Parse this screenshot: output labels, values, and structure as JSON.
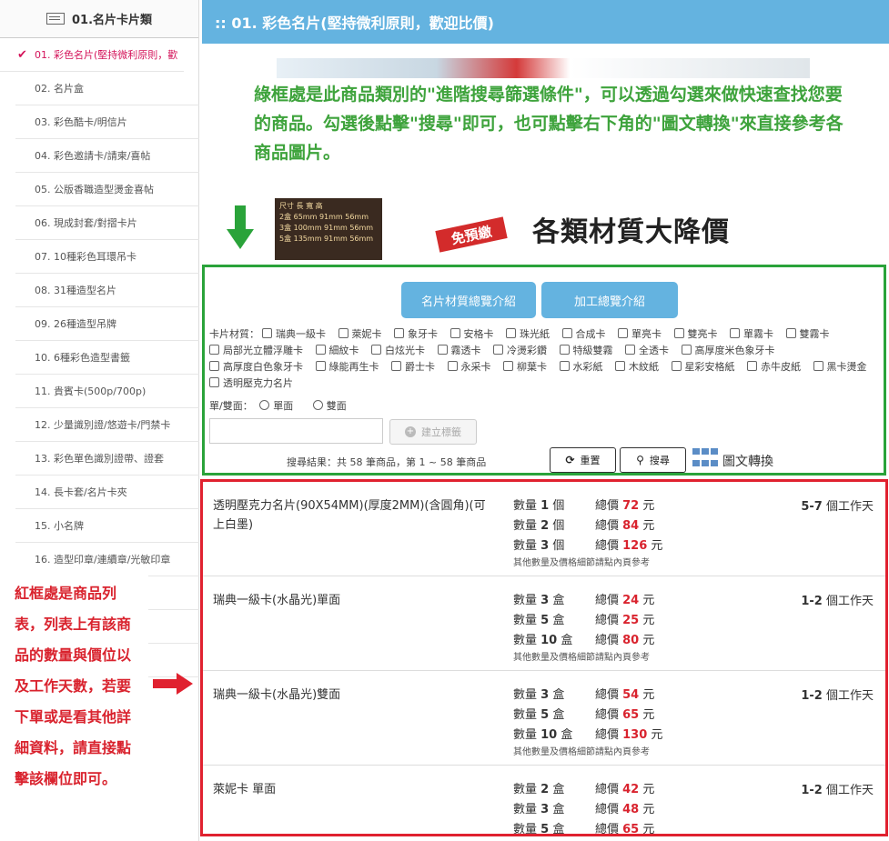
{
  "sidebar": {
    "header": "01.名片卡片類",
    "items": [
      "01. 彩色名片(堅持微利原則，歡",
      "02. 名片盒",
      "03. 彩色酷卡/明信片",
      "04. 彩色邀請卡/請柬/喜帖",
      "05. 公版香職造型燙金喜帖",
      "06. 現成封套/對摺卡片",
      "07. 10種彩色耳環吊卡",
      "08. 31種造型名片",
      "09. 26種造型吊牌",
      "10. 6種彩色造型書籤",
      "11. 貴賓卡(500p/700p)",
      "12. 少量識別證/悠遊卡/門禁卡",
      "13. 彩色單色識別證帶、證套",
      "14. 長卡套/名片卡夾",
      "15. 小名牌",
      "16. 造型印章/連續章/光敏印章",
      "",
      "",
      ""
    ]
  },
  "title": ":: 01. 彩色名片(堅持微利原則，歡迎比價)",
  "banner": {
    "table_text": [
      "尺寸 長 寬 高",
      "2盒 65mm 91mm 56mm",
      "3盒 100mm 91mm 56mm",
      "5盒 135mm 91mm 56mm"
    ],
    "badge": "免預繳",
    "headline": "各類材質大降價"
  },
  "green_note": "綠框處是此商品類別的\"進階搜尋篩選條件\"，可以透過勾選來做快速查找您要的商品。勾選後點擊\"搜尋\"即可，也可點擊右下角的\"圖文轉換\"來直接參考各商品圖片。",
  "search": {
    "btn_material": "名片材質總覽介紹",
    "btn_process": "加工總覽介紹",
    "material_label": "卡片材質：",
    "materials": [
      "瑞典一級卡",
      "萊妮卡",
      "象牙卡",
      "安格卡",
      "珠光紙",
      "合成卡",
      "單亮卡",
      "雙亮卡",
      "單霧卡",
      "雙霧卡",
      "局部光立體浮雕卡",
      "細紋卡",
      "白炫光卡",
      "霧透卡",
      "冷燙彩鑽",
      "特級雙霧",
      "全透卡",
      "高厚度米色象牙卡",
      "高厚度白色象牙卡",
      "綠能再生卡",
      "爵士卡",
      "永采卡",
      "柳葉卡",
      "水彩紙",
      "木紋紙",
      "星彩安格紙",
      "赤牛皮紙",
      "黑卡燙金",
      "透明壓克力名片"
    ],
    "side_label": "單/雙面：",
    "sides": [
      "單面",
      "雙面"
    ],
    "tag_button": "建立標籤",
    "results": "搜尋結果：共 58 筆商品，第 1 ~ 58 筆商品",
    "reset": "重置",
    "search": "搜尋",
    "switch": "圖文轉換"
  },
  "products": [
    {
      "name": "透明壓克力名片(90X54MM)(厚度2MM)(含圓角)(可上白墨)",
      "prices": [
        {
          "qty_pre": "數量 ",
          "qty": "1",
          "unit": " 個",
          "price": "72"
        },
        {
          "qty_pre": "數量 ",
          "qty": "2",
          "unit": " 個",
          "price": "84"
        },
        {
          "qty_pre": "數量 ",
          "qty": "3",
          "unit": " 個",
          "price": "126"
        }
      ],
      "more": "其他數量及價格細節請點內頁參考",
      "days": "5-7",
      "days_unit": " 個工作天"
    },
    {
      "name": "瑞典一級卡(水晶光)單面",
      "prices": [
        {
          "qty_pre": "數量 ",
          "qty": "3",
          "unit": " 盒",
          "price": "24"
        },
        {
          "qty_pre": "數量 ",
          "qty": "5",
          "unit": " 盒",
          "price": "25"
        },
        {
          "qty_pre": "數量 ",
          "qty": "10",
          "unit": " 盒",
          "price": "80"
        }
      ],
      "more": "其他數量及價格細節請點內頁參考",
      "days": "1-2",
      "days_unit": " 個工作天"
    },
    {
      "name": "瑞典一級卡(水晶光)雙面",
      "prices": [
        {
          "qty_pre": "數量 ",
          "qty": "3",
          "unit": " 盒",
          "price": "54"
        },
        {
          "qty_pre": "數量 ",
          "qty": "5",
          "unit": " 盒",
          "price": "65"
        },
        {
          "qty_pre": "數量 ",
          "qty": "10",
          "unit": " 盒",
          "price": "130"
        }
      ],
      "more": "其他數量及價格細節請點內頁參考",
      "days": "1-2",
      "days_unit": " 個工作天"
    },
    {
      "name": "萊妮卡 單面",
      "prices": [
        {
          "qty_pre": "數量 ",
          "qty": "2",
          "unit": " 盒",
          "price": "42"
        },
        {
          "qty_pre": "數量 ",
          "qty": "3",
          "unit": " 盒",
          "price": "48"
        },
        {
          "qty_pre": "數量 ",
          "qty": "5",
          "unit": " 盒",
          "price": "65"
        }
      ],
      "more": "",
      "days": "1-2",
      "days_unit": " 個工作天"
    }
  ],
  "price_label": "總價 ",
  "currency": " 元",
  "red_note": "紅框處是商品列表，列表上有該商品的數量與價位以及工作天數，若要下單或是看其他詳細資料，請直接點擊該欄位即可。",
  "colors": {
    "accent": "#64b3e0",
    "green": "#2aa33a",
    "red": "#e0212f",
    "active": "#d4145a"
  }
}
